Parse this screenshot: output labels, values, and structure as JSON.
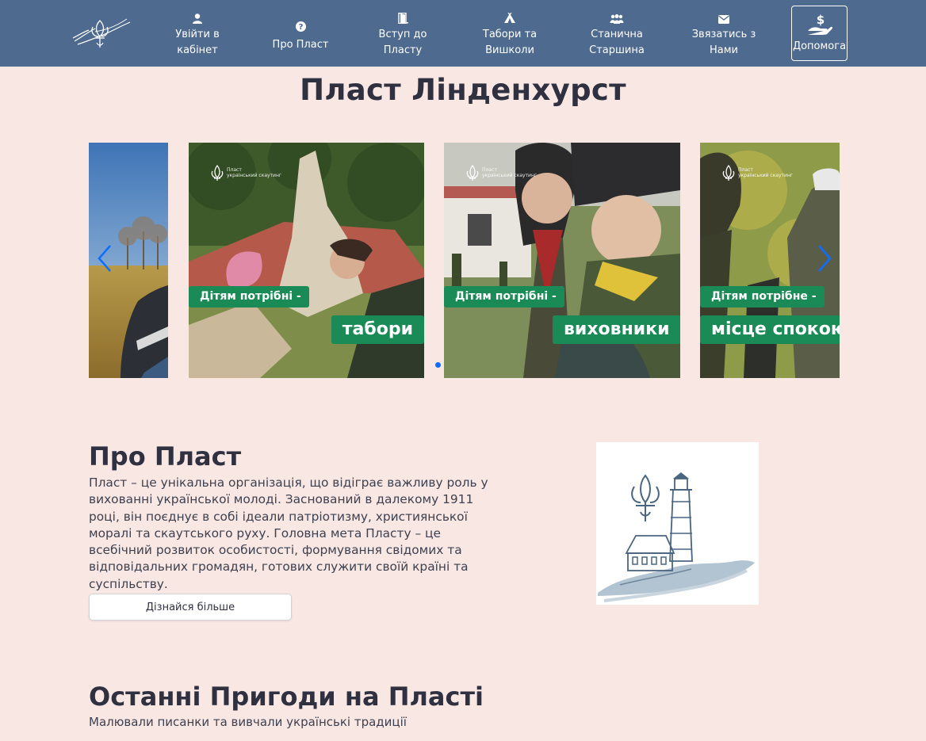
{
  "nav": {
    "items": [
      {
        "label": "Увійти в\nкабінет",
        "icon": "user-icon"
      },
      {
        "label": "Про Пласт",
        "icon": "question-circle-icon"
      },
      {
        "label": "Вступ до\nПласту",
        "icon": "door-icon"
      },
      {
        "label": "Табори та\nВишколи",
        "icon": "tent-icon"
      },
      {
        "label": "Станична\nСтаршина",
        "icon": "people-icon"
      },
      {
        "label": "Звязатись з\nНами",
        "icon": "envelope-icon"
      }
    ],
    "help_label": "Допомога",
    "help_icon": "donate-hand-icon"
  },
  "page_title": "Пласт Лінденхурст",
  "carousel": {
    "slides": [
      {
        "tag_small": "Дітям потрібні -",
        "tag_big": "табори",
        "brand": "Пласт",
        "brand_sub": "український скаутинг"
      },
      {
        "tag_small": "Дітям потрібні -",
        "tag_big": "виховники",
        "brand": "Пласт",
        "brand_sub": "український скаутинг"
      },
      {
        "tag_small": "Дітям потрібне -",
        "tag_big": "місце спокою",
        "brand": "Пласт",
        "brand_sub": "український скаутинг"
      }
    ],
    "accent": "#1a8a56",
    "arrow_color": "#0d6efd"
  },
  "about": {
    "title": "Про Пласт",
    "text": "Пласт – це унікальна організація, що відіграє важливу роль у вихованні української молоді. Заснований в далекому 1911 році, він поєднує в собі ідеали патріотизму, християнської моралі та скаутського руху. Головна мета Пласту – це всебічний розвиток особистості, формування свідомих та відповідальних громадян, готових служити своїй країні та суспільству.",
    "button_label": "Дізнайся більше"
  },
  "latest": {
    "title": "Останні Пригоди на Пласті",
    "subtitle": "Малювали писанки та вивчали українські традиції"
  },
  "colors": {
    "navbar": "#4e6a8f",
    "background": "#f9e7e4",
    "text": "#2f3140"
  }
}
